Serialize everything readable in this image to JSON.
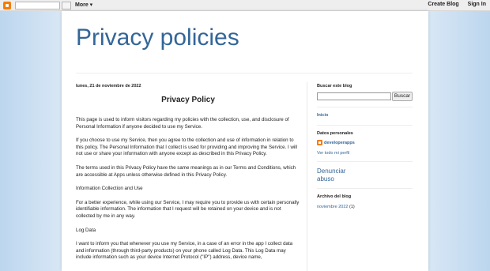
{
  "navbar": {
    "more_label": "More ▾",
    "create_blog": "Create Blog",
    "sign_in": "Sign In"
  },
  "blog": {
    "title": "Privacy policies"
  },
  "post": {
    "date": "lunes, 21 de noviembre de 2022",
    "title": "Privacy Policy",
    "paragraphs": [
      "This page is used to inform visitors regarding my policies with the collection, use, and disclosure of Personal Information if anyone decided to use my Service.",
      "If you choose to use my Service, then you agree to the collection and use of information in relation to this policy. The Personal Information that I collect is used for providing and improving the Service. I will not use or share your information with anyone except as described in this Privacy Policy.",
      "The terms used in this Privacy Policy have the same meanings as in our Terms and Conditions, which are accessible at Apps unless otherwise defined in this Privacy Policy.",
      "Information Collection and Use",
      "For a better experience, while using our Service, I may require you to provide us with certain personally identifiable information. The information that I request will be retained on your device and is not collected by me in any way.",
      "Log Data",
      "I want to inform you that whenever you use my Service, in a case of an error in the app I collect data and information (through third-party products) on your phone called Log Data. This Log Data may include information such as your device Internet Protocol (\"IP\") address, device name,"
    ]
  },
  "sidebar": {
    "search_heading": "Buscar este blog",
    "search_button": "Buscar",
    "home_link": "Inicio",
    "profile_heading": "Datos personales",
    "profile_name": "developerapps",
    "profile_link": "Ver todo mi perfil",
    "report_abuse": "Denunciar abuso",
    "archive_heading": "Archivo del blog",
    "archive_month": "noviembre 2022",
    "archive_count": "(1)"
  },
  "colors": {
    "accent": "#336699",
    "background": "#cfe2f3",
    "logo": "#f57d00"
  }
}
